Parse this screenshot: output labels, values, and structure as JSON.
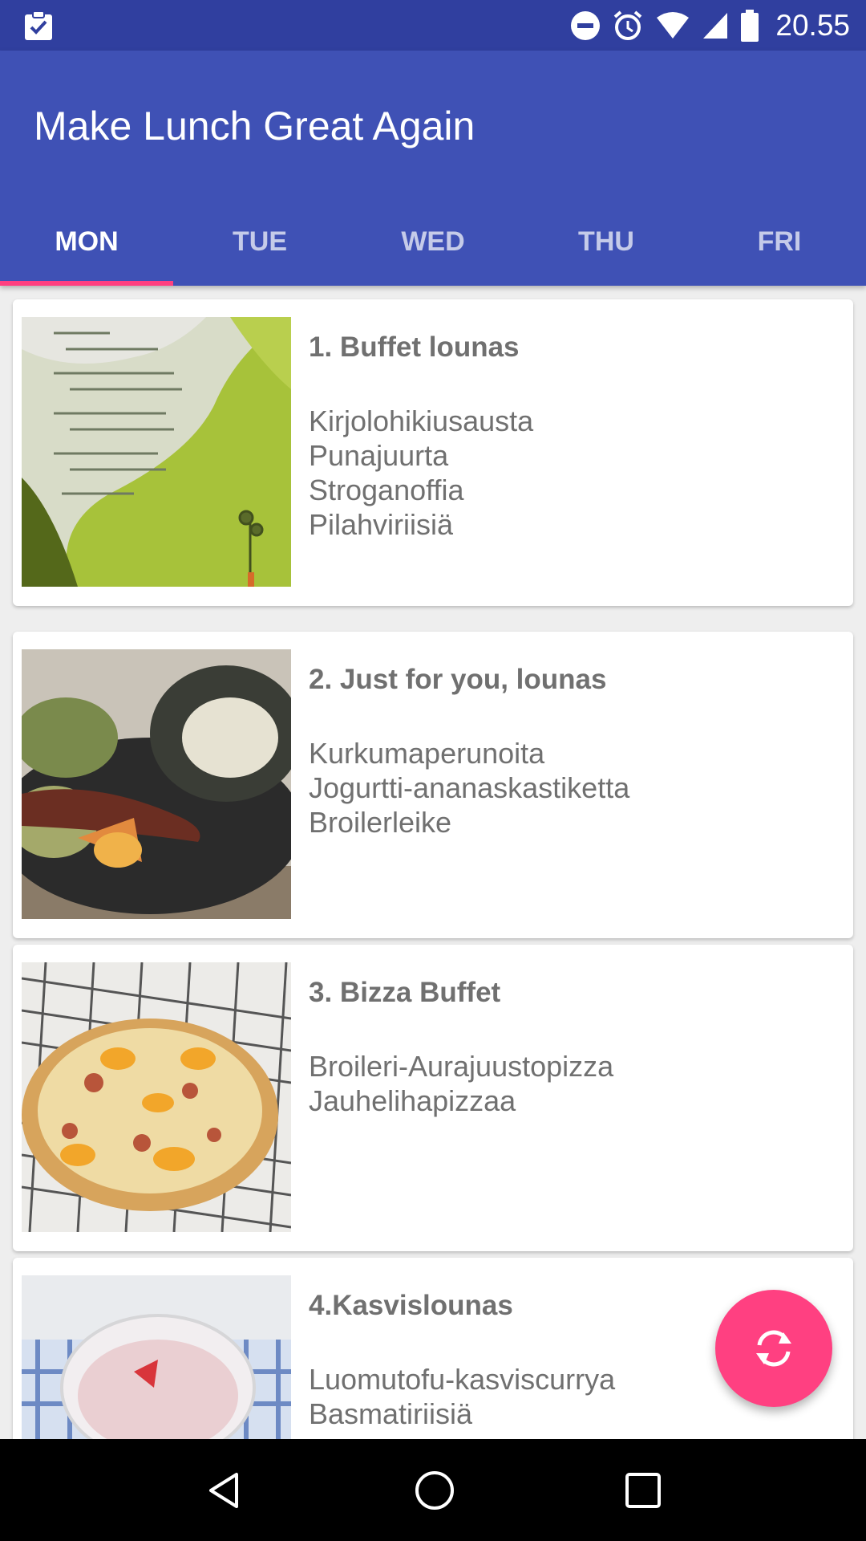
{
  "status_bar": {
    "time": "20.55",
    "icons": [
      "clipboard-check-icon",
      "do-not-disturb-icon",
      "alarm-icon",
      "wifi-icon",
      "signal-icon",
      "battery-icon"
    ]
  },
  "app_bar": {
    "title": "Make Lunch Great Again",
    "background_color": "#3f51b5",
    "status_color": "#303f9f"
  },
  "tabs": [
    {
      "label": "MON",
      "active": true
    },
    {
      "label": "TUE",
      "active": false
    },
    {
      "label": "WED",
      "active": false
    },
    {
      "label": "THU",
      "active": false
    },
    {
      "label": "FRI",
      "active": false
    }
  ],
  "accent_color": "#ff4081",
  "menu": [
    {
      "title": "1. Buffet lounas",
      "items": [
        "Kirjolohikiusausta",
        "Punajuurta",
        "Stroganoffia",
        "Pilahviriisiä"
      ],
      "image": "menu-photo"
    },
    {
      "title": "2. Just for you, lounas",
      "items": [
        "Kurkumaperunoita",
        "Jogurtti-ananaskastiketta",
        "Broilerleike"
      ],
      "image": "sausage-plate-photo"
    },
    {
      "title": "3. Bizza Buffet",
      "items": [
        "Broileri-Aurajuustopizza",
        "Jauhelihapizzaa"
      ],
      "image": "pizza-photo"
    },
    {
      "title": "4.Kasvislounas",
      "items": [
        "Luomutofu-kasviscurrya",
        "Basmatiriisiä"
      ],
      "image": "dessert-bowl-photo"
    }
  ],
  "fab": {
    "icon": "refresh-icon"
  },
  "nav_bar": {
    "icons": [
      "back-icon",
      "home-icon",
      "recents-icon"
    ]
  }
}
